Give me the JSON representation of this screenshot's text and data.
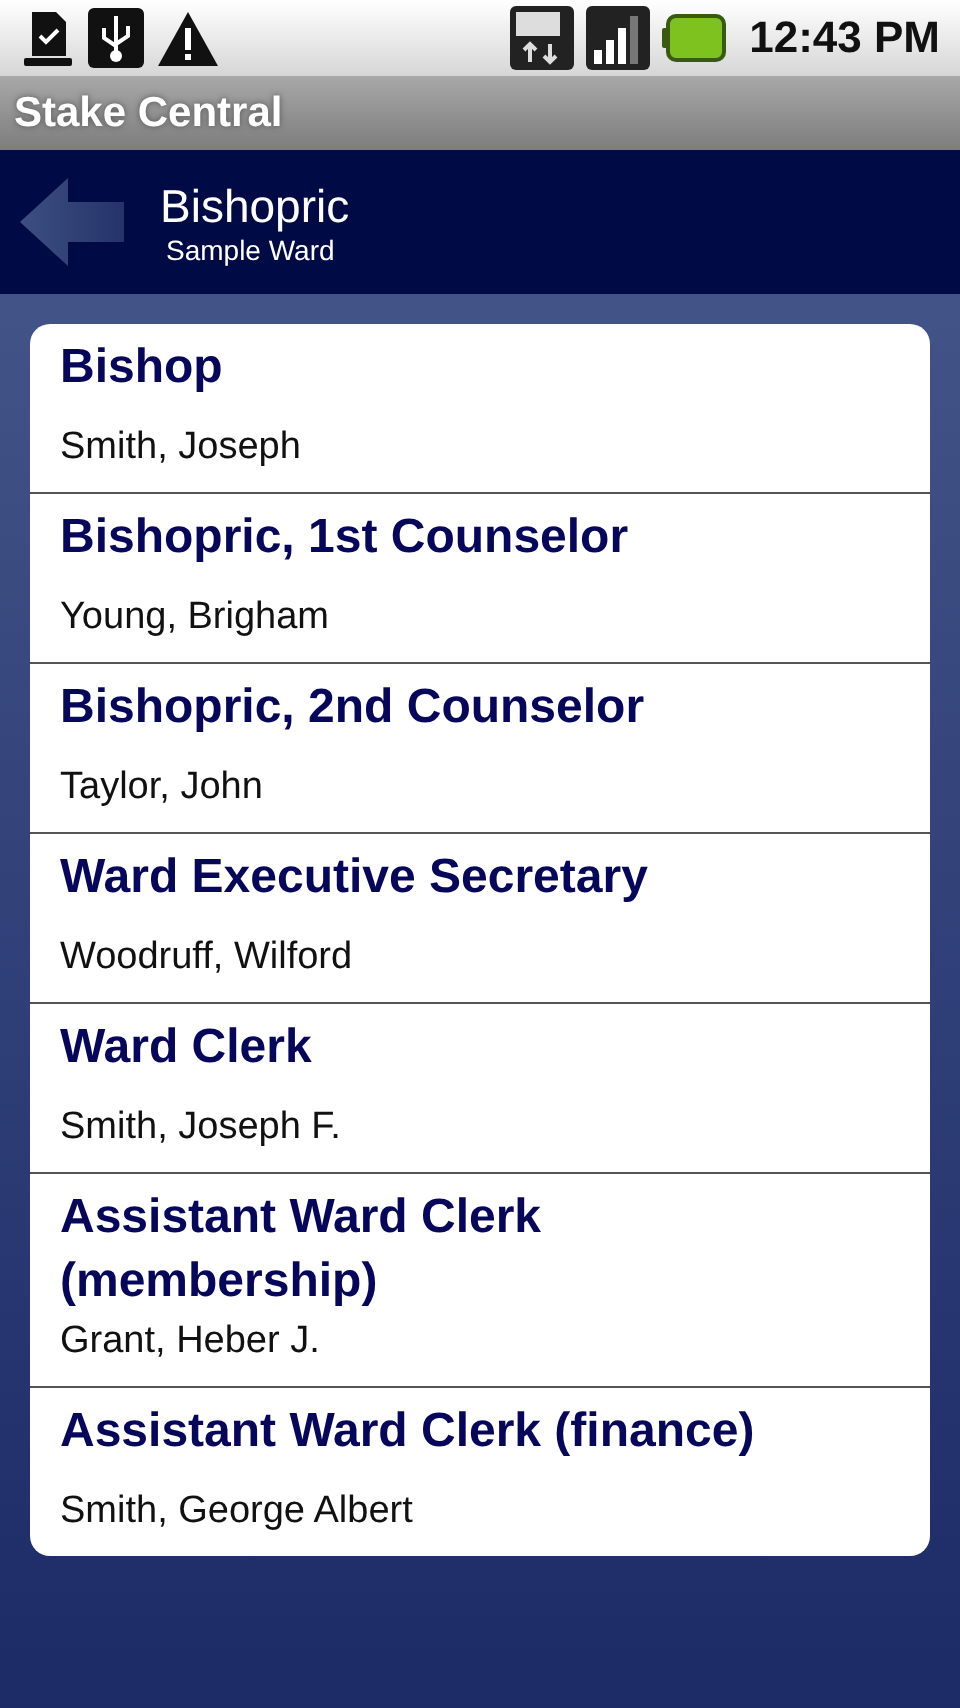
{
  "status_bar": {
    "time": "12:43 PM"
  },
  "app_bar": {
    "title": "Stake Central"
  },
  "header": {
    "title": "Bishopric",
    "subtitle": "Sample Ward"
  },
  "positions": [
    {
      "title": "Bishop",
      "name": "Smith, Joseph"
    },
    {
      "title": "Bishopric, 1st Counselor",
      "name": "Young, Brigham"
    },
    {
      "title": "Bishopric, 2nd Counselor",
      "name": "Taylor, John"
    },
    {
      "title": "Ward Executive Secretary",
      "name": "Woodruff, Wilford"
    },
    {
      "title": "Ward Clerk",
      "name": "Smith, Joseph F."
    },
    {
      "title": "Assistant Ward Clerk (membership)",
      "name": "Grant, Heber J."
    },
    {
      "title": "Assistant Ward Clerk (finance)",
      "name": "Smith, George Albert"
    }
  ]
}
